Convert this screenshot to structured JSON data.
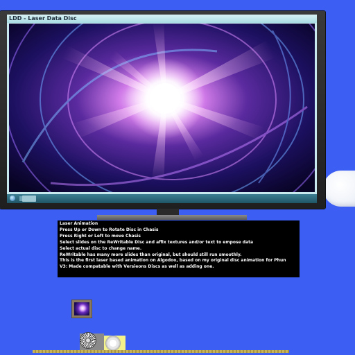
{
  "window": {
    "title": "LDD - Laser Data Disc"
  },
  "info": {
    "lines": [
      "Laser Animation",
      "Press Up or Down to Rotate Disc in Chasis",
      "Press Right or Left to move Chasis",
      "Select slides on the ReWritable Disc and affix textures and/or text to empose data",
      "Select actual disc to change name.",
      "ReWritable has many more slides than original, but should still run smoothly.",
      "This is the first laser based animation on Algodoo, based on my original disc animation for Phun",
      "V3: Made compatable with Versieons Discs as well as adding one."
    ]
  },
  "colors": {
    "background": "#3c5ef2",
    "screen_frame": "#2a2a2a",
    "info_background": "#000000",
    "info_text": "#ffffff"
  },
  "icons": {
    "start": "windows-start-orb-icon",
    "disc": "spinning-disc-icon",
    "disc2": "white-disc-icon"
  }
}
